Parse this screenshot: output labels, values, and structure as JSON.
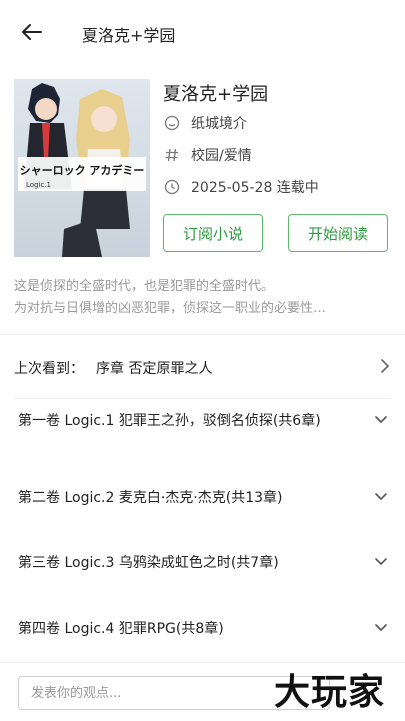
{
  "header": {
    "title": "夏洛克+学园"
  },
  "book": {
    "title": "夏洛克+学园",
    "author": "纸城境介",
    "tags": "校园/爱情",
    "update": "2025-05-28 连载中",
    "cover_text": "シャーロック アカデミー",
    "cover_sub": "Logic.1"
  },
  "actions": {
    "subscribe": "订阅小说",
    "read": "开始阅读"
  },
  "description": [
    "这是侦探的全盛时代，也是犯罪的全盛时代。",
    "为对抗与日俱增的凶恶犯罪，侦探这一职业的必要性…"
  ],
  "last_read": {
    "label": "上次看到：",
    "chapter": "序章 否定原罪之人"
  },
  "volumes": [
    {
      "title": "第一卷 Logic.1 犯罪王之孙，驳倒名侦探(共6章)"
    },
    {
      "title": "第二卷 Logic.2 麦克白·杰克·杰克(共13章)"
    },
    {
      "title": "第三卷 Logic.3 乌鸦染成虹色之时(共7章)"
    },
    {
      "title": "第四卷 Logic.4 犯罪RPG(共8章)"
    }
  ],
  "comment": {
    "placeholder": "发表你的观点..."
  },
  "watermark": "大玩家",
  "colors": {
    "accent": "#2f9a3f",
    "accent_border": "#5eb86a",
    "muted_text": "#9a9a9a"
  }
}
